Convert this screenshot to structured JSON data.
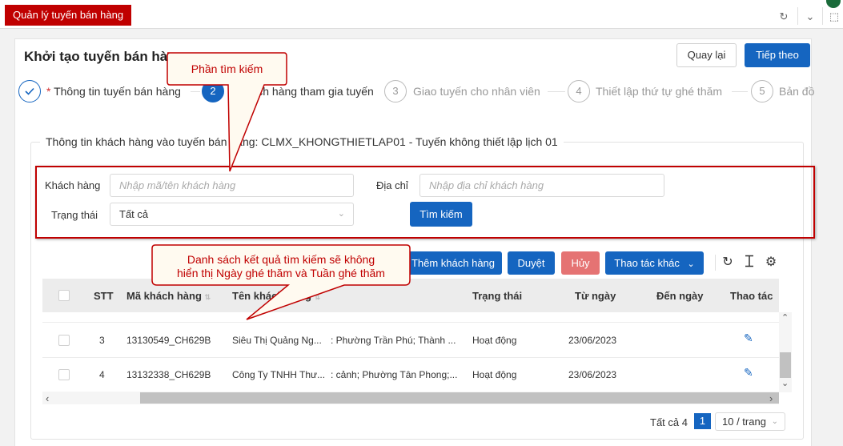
{
  "app": {
    "tab_label": "Quản lý tuyến bán hàng"
  },
  "page": {
    "title": "Khởi tạo tuyến bán hàng",
    "back_label": "Quay lại",
    "next_label": "Tiếp theo"
  },
  "steps": [
    {
      "number": "",
      "label": "Thông tin tuyến bán hàng",
      "required": "*",
      "state": "done"
    },
    {
      "number": "2",
      "label": "Khách hàng tham gia tuyến",
      "required": "*",
      "state": "active"
    },
    {
      "number": "3",
      "label": "Giao tuyến cho nhân viên",
      "required": "",
      "state": "pending"
    },
    {
      "number": "4",
      "label": "Thiết lập thứ tự ghé thăm",
      "required": "",
      "state": "pending"
    },
    {
      "number": "5",
      "label": "Bản đồ",
      "required": "",
      "state": "pending"
    }
  ],
  "section": {
    "legend": "Thông tin khách hàng vào tuyến bán hàng: CLMX_KHONGTHIETLAP01 - Tuyến không thiết lập lịch 01"
  },
  "search": {
    "customer_label": "Khách hàng",
    "customer_placeholder": "Nhập mã/tên khách hàng",
    "address_label": "Địa chỉ",
    "address_placeholder": "Nhập địa chỉ khách hàng",
    "status_label": "Trạng thái",
    "status_value": "Tất cả",
    "search_button": "Tìm kiếm"
  },
  "actions": {
    "add_customer": "Thêm khách hàng",
    "approve": "Duyệt",
    "cancel": "Hủy",
    "more_actions": "Thao tác khác"
  },
  "table": {
    "headers": [
      "STT",
      "Mã khách hàng",
      "Tên khách hàng",
      "Trạng thái",
      "Từ ngày",
      "Đến ngày",
      "Thao tác"
    ],
    "rows": [
      {
        "stt": "3",
        "code": "13130549_CH629B",
        "name": "Siêu Thị Quảng Ng...",
        "address": ": Phường Trần Phú; Thành ...",
        "status": "Hoạt động",
        "from": "23/06/2023",
        "to": ""
      },
      {
        "stt": "4",
        "code": "13132338_CH629B",
        "name": "Công Ty TNHH Thư...",
        "address": ": cảnh; Phường Tân Phong;...",
        "status": "Hoạt động",
        "from": "23/06/2023",
        "to": ""
      }
    ]
  },
  "pagination": {
    "total": "Tất cả 4",
    "current_page": "1",
    "page_size": "10 / trang"
  },
  "annotations": {
    "search_callout": "Phần tìm kiếm",
    "result_callout_line1": "Danh sách kết quả tìm kiếm sẽ không",
    "result_callout_line2": "hiển thị Ngày ghé thăm và Tuần ghé thăm"
  },
  "colors": {
    "primary": "#1565c0",
    "brand_red": "#c00000",
    "danger_light": "#e57373"
  }
}
